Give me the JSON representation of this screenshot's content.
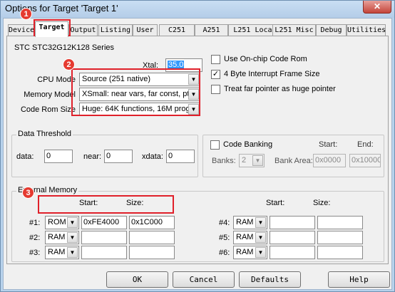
{
  "window": {
    "title": "Options for Target 'Target 1'",
    "close_glyph": "✕"
  },
  "tabs": [
    "Device",
    "Target",
    "Output",
    "Listing",
    "User",
    "C251",
    "A251",
    "L251 Locate",
    "L251 Misc",
    "Debug",
    "Utilities"
  ],
  "target": {
    "device_name": "STC STC32G12K128 Series",
    "xtal_label": "Xtal:",
    "xtal_value": "35.0",
    "cpu_mode_label": "CPU Mode",
    "cpu_mode_value": "Source (251 native)",
    "memory_model_label": "Memory Model",
    "memory_model_value": "XSmall: near vars, far const, ptr-4",
    "code_rom_label": "Code Rom Size",
    "code_rom_value": "Huge: 64K functions, 16M progr.",
    "options": [
      {
        "label": "Use On-chip Code Rom",
        "checked": false
      },
      {
        "label": "4 Byte Interrupt Frame Size",
        "checked": true
      },
      {
        "label": "Treat far pointer as huge pointer",
        "checked": false
      }
    ],
    "check_glyph": "✓"
  },
  "data_threshold": {
    "title": "Data Threshold",
    "data_label": "data:",
    "data_value": "0",
    "near_label": "near:",
    "near_value": "0",
    "xdata_label": "xdata:",
    "xdata_value": "0"
  },
  "code_banking": {
    "label": "Code Banking",
    "start_label": "Start:",
    "end_label": "End:",
    "banks_label": "Banks:",
    "banks_value": "2",
    "bank_area_label": "Bank Area:",
    "start_value": "0x0000",
    "end_value": "0x10000"
  },
  "external_memory": {
    "title": "External Memory",
    "start_header": "Start:",
    "size_header": "Size:",
    "rows_left": [
      {
        "label": "#1:",
        "type": "ROM",
        "start": "0xFE4000",
        "size": "0x1C000"
      },
      {
        "label": "#2:",
        "type": "RAM",
        "start": "",
        "size": ""
      },
      {
        "label": "#3:",
        "type": "RAM",
        "start": "",
        "size": ""
      }
    ],
    "rows_right": [
      {
        "label": "#4:",
        "type": "RAM",
        "start": "",
        "size": ""
      },
      {
        "label": "#5:",
        "type": "RAM",
        "start": "",
        "size": ""
      },
      {
        "label": "#6:",
        "type": "RAM",
        "start": "",
        "size": ""
      }
    ]
  },
  "buttons": {
    "ok": "OK",
    "cancel": "Cancel",
    "defaults": "Defaults",
    "help": "Help"
  },
  "annotations": {
    "badge1": "1",
    "badge2": "2",
    "badge3": "3"
  },
  "dropdown_glyph": "▼",
  "colors": {
    "annotation_red": "#e0202a",
    "selection_blue": "#3399ff",
    "title_bar": "#b8d2ec"
  }
}
